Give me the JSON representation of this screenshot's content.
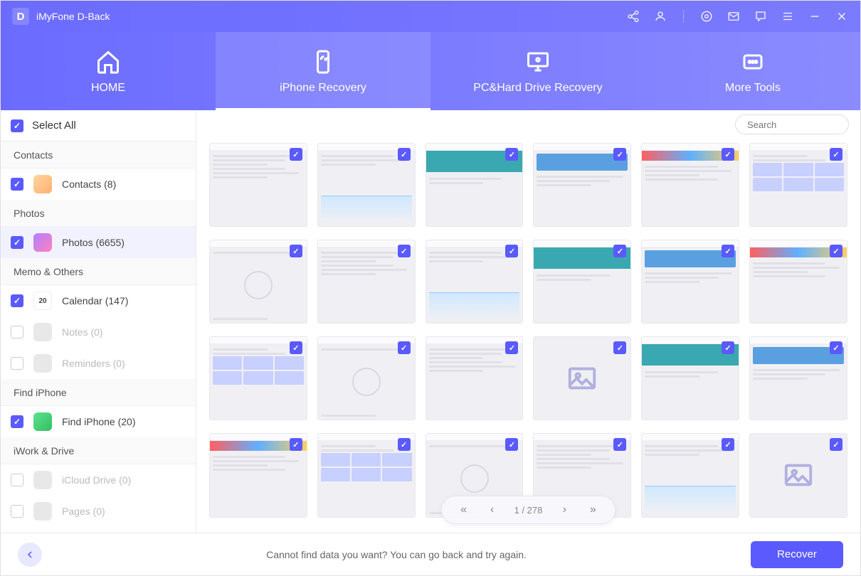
{
  "app": {
    "logo": "D",
    "title": "iMyFone D-Back"
  },
  "nav": {
    "tabs": [
      {
        "label": "HOME",
        "active": false
      },
      {
        "label": "iPhone Recovery",
        "active": true
      },
      {
        "label": "PC&Hard Drive Recovery",
        "active": false
      },
      {
        "label": "More Tools",
        "active": false
      }
    ]
  },
  "sidebar": {
    "select_all_label": "Select All",
    "sections": [
      {
        "header": "Contacts",
        "items": [
          {
            "label": "Contacts (8)",
            "checked": true,
            "icon": "contacts",
            "enabled": true
          }
        ]
      },
      {
        "header": "Photos",
        "items": [
          {
            "label": "Photos (6655)",
            "checked": true,
            "icon": "photos",
            "enabled": true,
            "active": true
          }
        ]
      },
      {
        "header": "Memo & Others",
        "items": [
          {
            "label": "Calendar (147)",
            "checked": true,
            "icon": "calendar",
            "icon_text": "20",
            "enabled": true
          },
          {
            "label": "Notes (0)",
            "checked": false,
            "icon": "notes",
            "enabled": false
          },
          {
            "label": "Reminders (0)",
            "checked": false,
            "icon": "reminders",
            "enabled": false
          }
        ]
      },
      {
        "header": "Find iPhone",
        "items": [
          {
            "label": "Find iPhone (20)",
            "checked": true,
            "icon": "findiphone",
            "enabled": true
          }
        ]
      },
      {
        "header": "iWork & Drive",
        "items": [
          {
            "label": "iCloud Drive (0)",
            "checked": false,
            "icon": "icloud",
            "enabled": false
          },
          {
            "label": "Pages (0)",
            "checked": false,
            "icon": "pages",
            "enabled": false
          }
        ]
      }
    ]
  },
  "search": {
    "placeholder": "Search"
  },
  "grid": {
    "items": [
      {
        "checked": true
      },
      {
        "checked": true
      },
      {
        "checked": true
      },
      {
        "checked": true
      },
      {
        "checked": true
      },
      {
        "checked": true
      },
      {
        "checked": true
      },
      {
        "checked": true
      },
      {
        "checked": true
      },
      {
        "checked": true
      },
      {
        "checked": true
      },
      {
        "checked": true
      },
      {
        "checked": true
      },
      {
        "checked": true
      },
      {
        "checked": true
      },
      {
        "checked": true,
        "placeholder": true
      },
      {
        "checked": true
      },
      {
        "checked": true
      },
      {
        "checked": true
      },
      {
        "checked": true
      },
      {
        "checked": true
      },
      {
        "checked": true
      },
      {
        "checked": true
      },
      {
        "checked": true,
        "placeholder": true
      }
    ]
  },
  "pagination": {
    "current": 1,
    "total": 278,
    "text": "1 / 278"
  },
  "footer": {
    "hint": "Cannot find data you want? You can go back and try again.",
    "recover_label": "Recover"
  },
  "colors": {
    "primary": "#5a5aff",
    "primary_gradient_start": "#6b6bff",
    "primary_gradient_end": "#8b8bff"
  }
}
